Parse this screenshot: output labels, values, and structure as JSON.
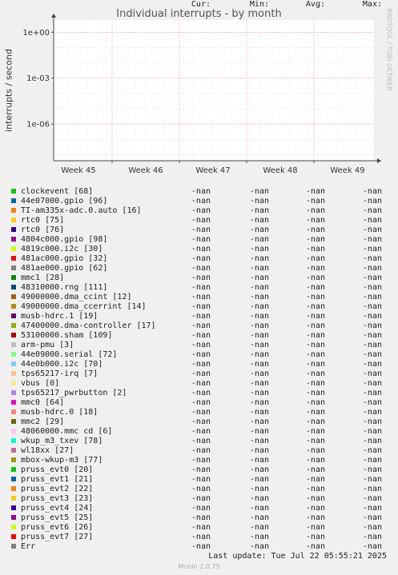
{
  "chart_data": {
    "type": "line",
    "title": "Individual interrupts - by month",
    "ylabel": "interrupts / second",
    "xlabel": "",
    "x_tick_labels": [
      "Week 45",
      "Week 46",
      "Week 47",
      "Week 48",
      "Week 49"
    ],
    "y_tick_labels": [
      "1e+00",
      "1e-03",
      "1e-06"
    ],
    "y_scale": "log",
    "grid": true,
    "legend_columns": [
      "Cur:",
      "Min:",
      "Avg:",
      "Max:"
    ],
    "series": [
      {
        "name": "clockevent [68]",
        "color": "#00cc00",
        "cur": "-nan",
        "min": "-nan",
        "avg": "-nan",
        "max": "-nan"
      },
      {
        "name": "44e07000.gpio [96]",
        "color": "#0066b3",
        "cur": "-nan",
        "min": "-nan",
        "avg": "-nan",
        "max": "-nan"
      },
      {
        "name": "TI-am335x-adc.0.auto [16]",
        "color": "#ff8000",
        "cur": "-nan",
        "min": "-nan",
        "avg": "-nan",
        "max": "-nan"
      },
      {
        "name": "rtc0 [75]",
        "color": "#ffcc00",
        "cur": "-nan",
        "min": "-nan",
        "avg": "-nan",
        "max": "-nan"
      },
      {
        "name": "rtc0 [76]",
        "color": "#330099",
        "cur": "-nan",
        "min": "-nan",
        "avg": "-nan",
        "max": "-nan"
      },
      {
        "name": "4804c000.gpio [98]",
        "color": "#990099",
        "cur": "-nan",
        "min": "-nan",
        "avg": "-nan",
        "max": "-nan"
      },
      {
        "name": "4819c000.i2c [30]",
        "color": "#ccff00",
        "cur": "-nan",
        "min": "-nan",
        "avg": "-nan",
        "max": "-nan"
      },
      {
        "name": "481ac000.gpio [32]",
        "color": "#ff0000",
        "cur": "-nan",
        "min": "-nan",
        "avg": "-nan",
        "max": "-nan"
      },
      {
        "name": "481ae000.gpio [62]",
        "color": "#808080",
        "cur": "-nan",
        "min": "-nan",
        "avg": "-nan",
        "max": "-nan"
      },
      {
        "name": "mmc1 [28]",
        "color": "#008f00",
        "cur": "-nan",
        "min": "-nan",
        "avg": "-nan",
        "max": "-nan"
      },
      {
        "name": "48310000.rng [111]",
        "color": "#00487d",
        "cur": "-nan",
        "min": "-nan",
        "avg": "-nan",
        "max": "-nan"
      },
      {
        "name": "49000000.dma_ccint [12]",
        "color": "#b35a00",
        "cur": "-nan",
        "min": "-nan",
        "avg": "-nan",
        "max": "-nan"
      },
      {
        "name": "49000000.dma_ccerrint [14]",
        "color": "#b38f00",
        "cur": "-nan",
        "min": "-nan",
        "avg": "-nan",
        "max": "-nan"
      },
      {
        "name": "musb-hdrc.1 [19]",
        "color": "#6b006b",
        "cur": "-nan",
        "min": "-nan",
        "avg": "-nan",
        "max": "-nan"
      },
      {
        "name": "47400000.dma-controller [17]",
        "color": "#8fb300",
        "cur": "-nan",
        "min": "-nan",
        "avg": "-nan",
        "max": "-nan"
      },
      {
        "name": "53100000.sham [109]",
        "color": "#b30000",
        "cur": "-nan",
        "min": "-nan",
        "avg": "-nan",
        "max": "-nan"
      },
      {
        "name": "arm-pmu [3]",
        "color": "#bebebe",
        "cur": "-nan",
        "min": "-nan",
        "avg": "-nan",
        "max": "-nan"
      },
      {
        "name": "44e09000.serial [72]",
        "color": "#80ff80",
        "cur": "-nan",
        "min": "-nan",
        "avg": "-nan",
        "max": "-nan"
      },
      {
        "name": "44e0b000.i2c [70]",
        "color": "#80c9ff",
        "cur": "-nan",
        "min": "-nan",
        "avg": "-nan",
        "max": "-nan"
      },
      {
        "name": "tps65217-irq [7]",
        "color": "#ffc080",
        "cur": "-nan",
        "min": "-nan",
        "avg": "-nan",
        "max": "-nan"
      },
      {
        "name": "vbus [0]",
        "color": "#ffe680",
        "cur": "-nan",
        "min": "-nan",
        "avg": "-nan",
        "max": "-nan"
      },
      {
        "name": "tps65217_pwrbutton [2]",
        "color": "#aa80ff",
        "cur": "-nan",
        "min": "-nan",
        "avg": "-nan",
        "max": "-nan"
      },
      {
        "name": "mmc0 [64]",
        "color": "#ee00cc",
        "cur": "-nan",
        "min": "-nan",
        "avg": "-nan",
        "max": "-nan"
      },
      {
        "name": "musb-hdrc.0 [18]",
        "color": "#ff8080",
        "cur": "-nan",
        "min": "-nan",
        "avg": "-nan",
        "max": "-nan"
      },
      {
        "name": "mmc2 [29]",
        "color": "#666600",
        "cur": "-nan",
        "min": "-nan",
        "avg": "-nan",
        "max": "-nan"
      },
      {
        "name": "48060000.mmc cd [6]",
        "color": "#ffbfff",
        "cur": "-nan",
        "min": "-nan",
        "avg": "-nan",
        "max": "-nan"
      },
      {
        "name": "wkup_m3_txev [78]",
        "color": "#00ffcc",
        "cur": "-nan",
        "min": "-nan",
        "avg": "-nan",
        "max": "-nan"
      },
      {
        "name": "wl18xx [27]",
        "color": "#cc6699",
        "cur": "-nan",
        "min": "-nan",
        "avg": "-nan",
        "max": "-nan"
      },
      {
        "name": "mbox-wkup-m3 [77]",
        "color": "#999900",
        "cur": "-nan",
        "min": "-nan",
        "avg": "-nan",
        "max": "-nan"
      },
      {
        "name": "pruss_evt0 [20]",
        "color": "#00cc00",
        "cur": "-nan",
        "min": "-nan",
        "avg": "-nan",
        "max": "-nan"
      },
      {
        "name": "pruss_evt1 [21]",
        "color": "#0066b3",
        "cur": "-nan",
        "min": "-nan",
        "avg": "-nan",
        "max": "-nan"
      },
      {
        "name": "pruss_evt2 [22]",
        "color": "#ff8000",
        "cur": "-nan",
        "min": "-nan",
        "avg": "-nan",
        "max": "-nan"
      },
      {
        "name": "pruss_evt3 [23]",
        "color": "#ffcc00",
        "cur": "-nan",
        "min": "-nan",
        "avg": "-nan",
        "max": "-nan"
      },
      {
        "name": "pruss_evt4 [24]",
        "color": "#330099",
        "cur": "-nan",
        "min": "-nan",
        "avg": "-nan",
        "max": "-nan"
      },
      {
        "name": "pruss_evt5 [25]",
        "color": "#990099",
        "cur": "-nan",
        "min": "-nan",
        "avg": "-nan",
        "max": "-nan"
      },
      {
        "name": "pruss_evt6 [26]",
        "color": "#ccff00",
        "cur": "-nan",
        "min": "-nan",
        "avg": "-nan",
        "max": "-nan"
      },
      {
        "name": "pruss_evt7 [27]",
        "color": "#ff0000",
        "cur": "-nan",
        "min": "-nan",
        "avg": "-nan",
        "max": "-nan"
      },
      {
        "name": "Err",
        "color": "#808080",
        "cur": "-nan",
        "min": "-nan",
        "avg": "-nan",
        "max": "-nan"
      }
    ]
  },
  "footer": {
    "last_update": "Last update: Tue Jul 22 05:55:21 2025",
    "version": "Munin 2.0.75"
  },
  "watermark": "RRDTOOL / TOBI OETIKER"
}
